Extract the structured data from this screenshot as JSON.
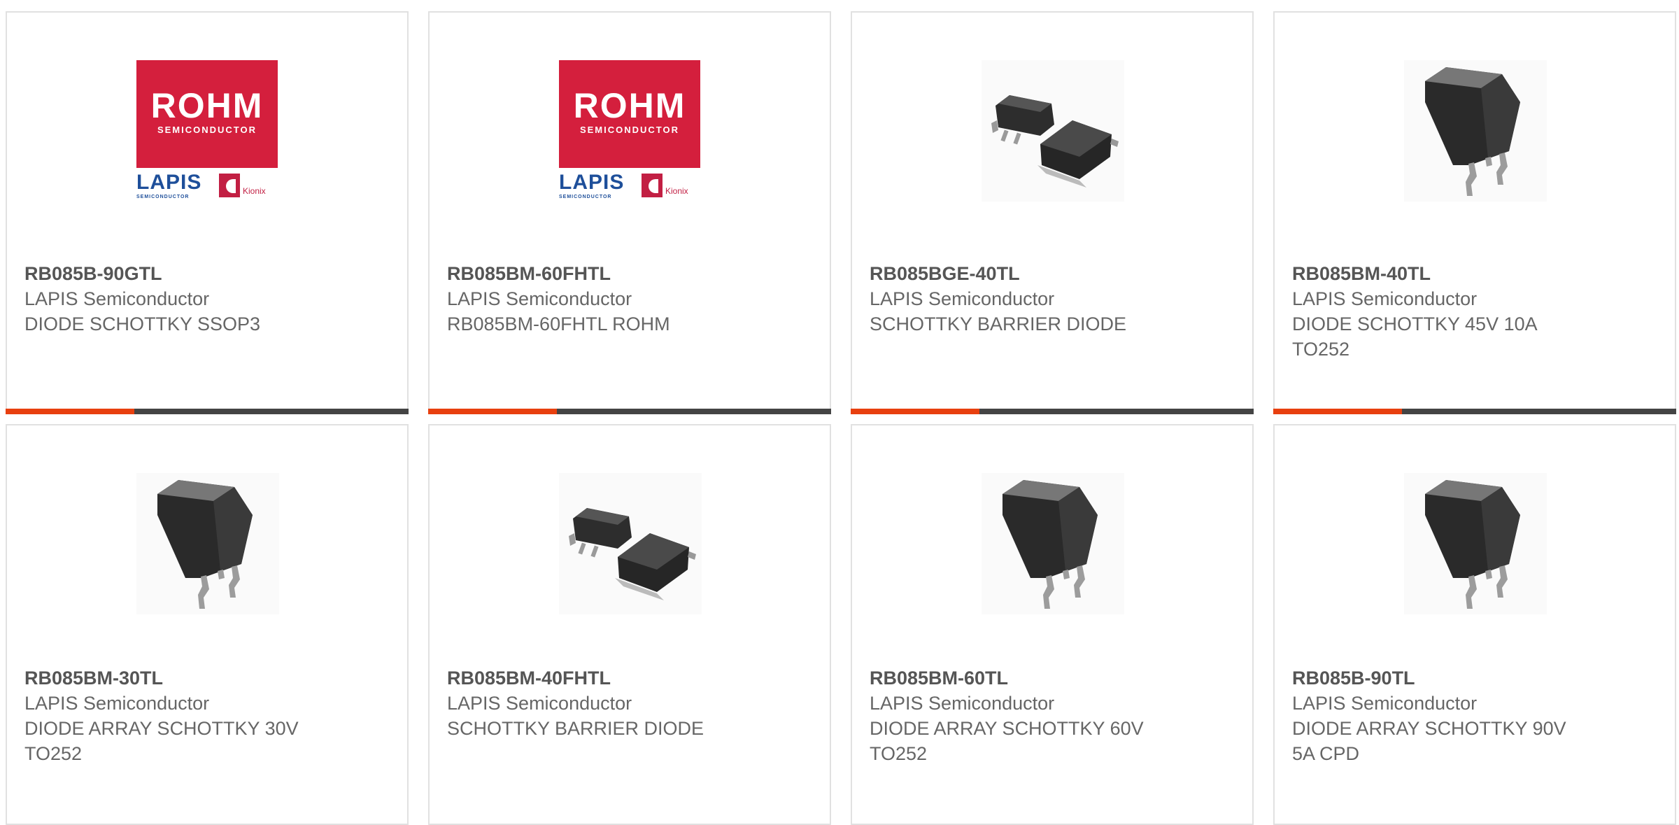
{
  "colors": {
    "accent": "#e8400f",
    "bar_dark": "#444444",
    "rohm_red": "#d41f3d",
    "lapis_blue": "#1e4f9a"
  },
  "logo": {
    "rohm": "ROHM",
    "rohm_sub": "SEMICONDUCTOR",
    "lapis": "LAPIS",
    "lapis_sub": "SEMICONDUCTOR",
    "kionix": "Kionix"
  },
  "products": [
    {
      "part": "RB085B-90GTL",
      "manufacturer": "LAPIS Semiconductor",
      "description": "DIODE SCHOTTKY SSOP3",
      "image": "rohm-logo"
    },
    {
      "part": "RB085BM-60FHTL",
      "manufacturer": "LAPIS Semiconductor",
      "description": "RB085BM-60FHTL ROHM",
      "image": "rohm-logo"
    },
    {
      "part": "RB085BGE-40TL",
      "manufacturer": "LAPIS Semiconductor",
      "description": "SCHOTTKY BARRIER DIODE",
      "image": "dpak-pair"
    },
    {
      "part": "RB085BM-40TL",
      "manufacturer": "LAPIS Semiconductor",
      "description": "DIODE SCHOTTKY 45V 10A\nTO252",
      "image": "dpak-single"
    },
    {
      "part": "RB085BM-30TL",
      "manufacturer": "LAPIS Semiconductor",
      "description": "DIODE ARRAY SCHOTTKY 30V\nTO252",
      "image": "dpak-single"
    },
    {
      "part": "RB085BM-40FHTL",
      "manufacturer": "LAPIS Semiconductor",
      "description": "SCHOTTKY BARRIER DIODE",
      "image": "dpak-pair"
    },
    {
      "part": "RB085BM-60TL",
      "manufacturer": "LAPIS Semiconductor",
      "description": "DIODE ARRAY SCHOTTKY 60V\nTO252",
      "image": "dpak-single"
    },
    {
      "part": "RB085B-90TL",
      "manufacturer": "LAPIS Semiconductor",
      "description": "DIODE ARRAY SCHOTTKY 90V\n5A CPD",
      "image": "dpak-single"
    }
  ]
}
